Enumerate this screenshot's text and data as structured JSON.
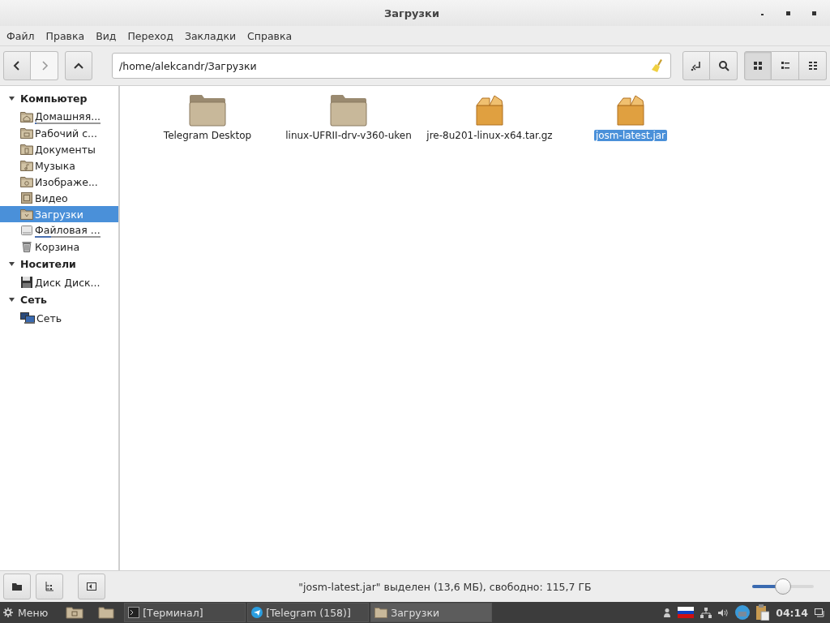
{
  "window": {
    "title": "Загрузки"
  },
  "menu": [
    "Файл",
    "Правка",
    "Вид",
    "Переход",
    "Закладки",
    "Справка"
  ],
  "toolbar": {
    "location": "/home/alekcandr/Загрузки",
    "views": [
      {
        "kind": "icons",
        "selected": true
      },
      {
        "kind": "compact",
        "selected": false
      },
      {
        "kind": "list",
        "selected": false
      }
    ]
  },
  "sidebar": [
    {
      "label": "Компьютер",
      "expanded": true,
      "children": [
        {
          "label": "Домашняя...",
          "kind": "home",
          "level": 0.03
        },
        {
          "label": "Рабочий с...",
          "kind": "desktop"
        },
        {
          "label": "Документы",
          "kind": "documents"
        },
        {
          "label": "Музыка",
          "kind": "music"
        },
        {
          "label": "Изображе...",
          "kind": "pictures"
        },
        {
          "label": "Видео",
          "kind": "video"
        },
        {
          "label": "Загрузки",
          "kind": "downloads",
          "selected": true
        },
        {
          "label": "Файловая ...",
          "kind": "filesystem",
          "level": 0.25
        },
        {
          "label": "Корзина",
          "kind": "trash"
        }
      ]
    },
    {
      "label": "Носители",
      "expanded": true,
      "children": [
        {
          "label": "Диск Диск...",
          "kind": "disk"
        }
      ]
    },
    {
      "label": "Сеть",
      "expanded": true,
      "children": [
        {
          "label": "Сеть",
          "kind": "network"
        }
      ]
    }
  ],
  "files": [
    {
      "name": "Telegram Desktop",
      "kind": "folder",
      "selected": false
    },
    {
      "name": "linux-UFRII-drv-v360-uken",
      "kind": "folder",
      "selected": false
    },
    {
      "name": "jre-8u201-linux-x64.tar.gz",
      "kind": "archive",
      "selected": false
    },
    {
      "name": "josm-latest.jar",
      "kind": "archive",
      "selected": true
    }
  ],
  "status_bar": {
    "text": "\"josm-latest.jar\" выделен (13,6 МБ), свободно: 115,7 ГБ",
    "zoom": {
      "level": 0.5
    }
  },
  "taskbar": {
    "menu": "Меню",
    "tasks": [
      {
        "label": "[Терминал]",
        "kind": "terminal",
        "selected": false
      },
      {
        "label": "[Telegram (158)]",
        "kind": "telegram",
        "selected": false
      },
      {
        "label": "Загрузки",
        "kind": "folder",
        "selected": true
      }
    ],
    "clock": "04:14"
  }
}
